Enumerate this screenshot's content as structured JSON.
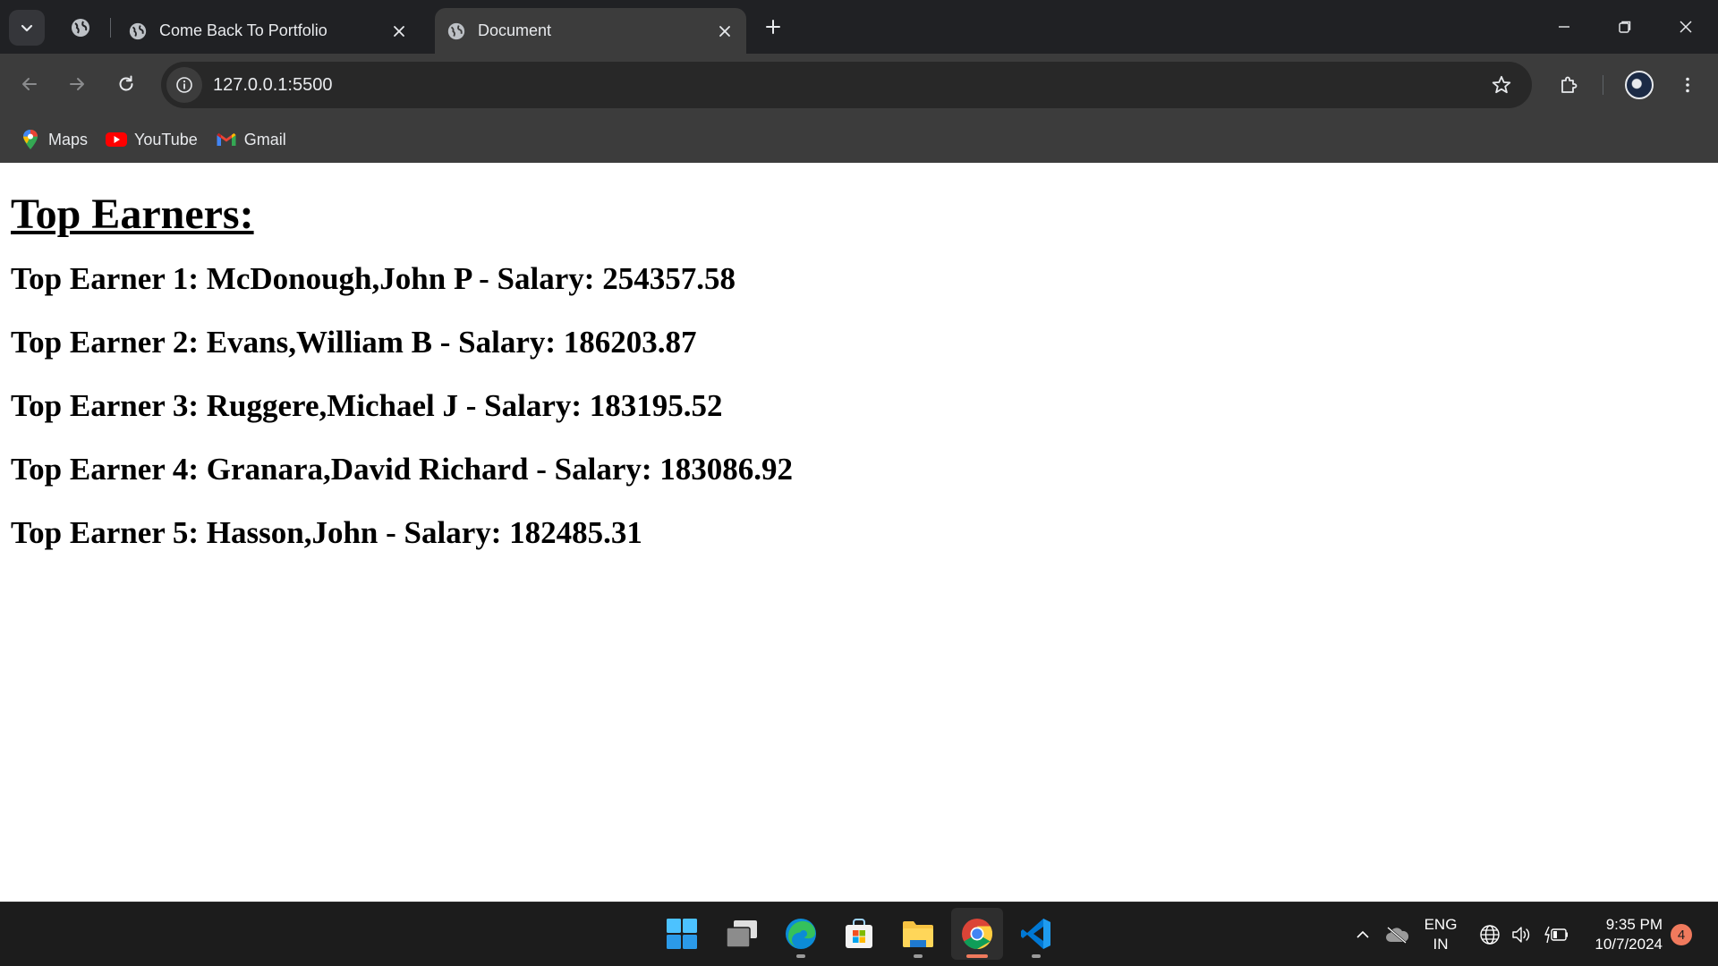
{
  "browser": {
    "tabs": [
      {
        "title": "Come Back To Portfolio",
        "active": false
      },
      {
        "title": "Document",
        "active": true
      }
    ],
    "address": "127.0.0.1:5500",
    "bookmarks": [
      {
        "label": "Maps",
        "icon": "maps-icon"
      },
      {
        "label": "YouTube",
        "icon": "youtube-icon"
      },
      {
        "label": "Gmail",
        "icon": "gmail-icon"
      }
    ]
  },
  "page": {
    "heading": "Top Earners:",
    "earners": [
      "Top Earner 1: McDonough,John P - Salary: 254357.58",
      "Top Earner 2: Evans,William B - Salary: 186203.87",
      "Top Earner 3: Ruggere,Michael J - Salary: 183195.52",
      "Top Earner 4: Granara,David Richard - Salary: 183086.92",
      "Top Earner 5: Hasson,John - Salary: 182485.31"
    ]
  },
  "taskbar": {
    "apps": [
      "windows-start-icon",
      "task-view-icon",
      "edge-icon",
      "microsoft-store-icon",
      "file-explorer-icon",
      "chrome-icon",
      "vscode-icon"
    ],
    "language": {
      "line1": "ENG",
      "line2": "IN"
    },
    "time": "9:35 PM",
    "date": "10/7/2024",
    "notification_count": "4"
  },
  "colors": {
    "chrome_frame": "#3c3c3c",
    "tabstrip": "#202124",
    "taskbar": "#1c1c1c",
    "accent": "#f07a5d"
  }
}
